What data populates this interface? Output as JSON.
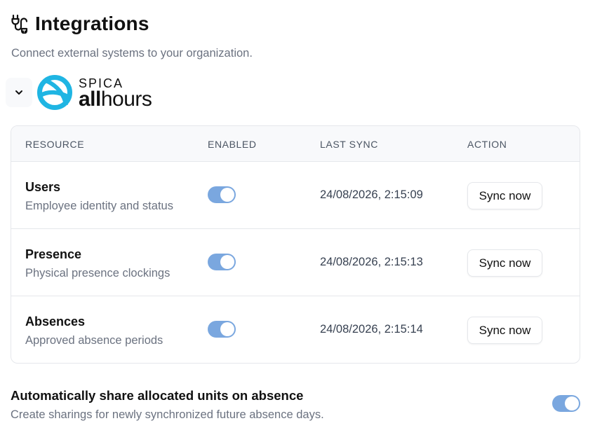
{
  "page": {
    "title": "Integrations",
    "subtitle": "Connect external systems to your organization."
  },
  "provider": {
    "logo_top": "SPICA",
    "logo_bold": "all",
    "logo_rest": "hours",
    "brand_color": "#1fb5e3"
  },
  "table": {
    "headers": {
      "resource": "RESOURCE",
      "enabled": "ENABLED",
      "last_sync": "LAST SYNC",
      "action": "ACTION"
    },
    "rows": [
      {
        "name": "Users",
        "description": "Employee identity and status",
        "enabled": true,
        "last_sync": "24/08/2026, 2:15:09",
        "action": "Sync now"
      },
      {
        "name": "Presence",
        "description": "Physical presence clockings",
        "enabled": true,
        "last_sync": "24/08/2026, 2:15:13",
        "action": "Sync now"
      },
      {
        "name": "Absences",
        "description": "Approved absence periods",
        "enabled": true,
        "last_sync": "24/08/2026, 2:15:14",
        "action": "Sync now"
      }
    ]
  },
  "auto_share": {
    "title": "Automatically share allocated units on absence",
    "description": "Create sharings for newly synchronized future absence days.",
    "enabled": true
  },
  "colors": {
    "toggle_on": "#7aa7df",
    "muted_text": "#6b7280",
    "border": "#e5e7eb"
  }
}
